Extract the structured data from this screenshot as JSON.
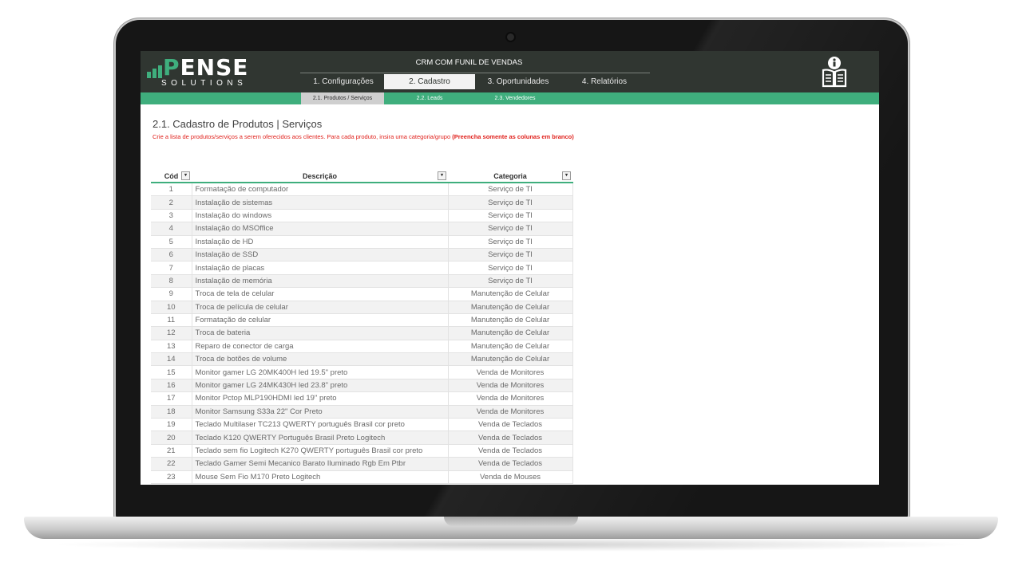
{
  "app": {
    "logo_main": "ENSE",
    "logo_letter": "P",
    "logo_sub": "SOLUTIONS",
    "title": "CRM COM FUNIL DE VENDAS"
  },
  "tabs": [
    {
      "label": "1. Configurações",
      "active": false
    },
    {
      "label": "2. Cadastro",
      "active": true
    },
    {
      "label": "3. Oportunidades",
      "active": false
    },
    {
      "label": "4. Relatórios",
      "active": false
    }
  ],
  "subtabs": [
    {
      "label": "2.1. Produtos / Serviços",
      "active": true
    },
    {
      "label": "2.2. Leads",
      "active": false
    },
    {
      "label": "2.3. Vendedores",
      "active": false
    }
  ],
  "page": {
    "title": "2.1. Cadastro de Produtos | Serviços",
    "instructions": "Crie a lista de produtos/serviços a serem oferecidos aos clientes. Para cada produto, insira uma categoria/grupo ",
    "instructions_bold": "(Preencha somente as colunas em branco)"
  },
  "table": {
    "headers": [
      "Cód",
      "Descrição",
      "Categoria"
    ],
    "filter_glyph": "▾",
    "rows": [
      [
        "1",
        "Formatação de computador",
        "Serviço de TI"
      ],
      [
        "2",
        "Instalação de sistemas",
        "Serviço de TI"
      ],
      [
        "3",
        "Instalação do windows",
        "Serviço de TI"
      ],
      [
        "4",
        "Instalação do MSOffice",
        "Serviço de TI"
      ],
      [
        "5",
        "Instalação de HD",
        "Serviço de TI"
      ],
      [
        "6",
        "Instalação de SSD",
        "Serviço de TI"
      ],
      [
        "7",
        "Instalação de placas",
        "Serviço de TI"
      ],
      [
        "8",
        "Instalação de memória",
        "Serviço de TI"
      ],
      [
        "9",
        "Troca de tela de celular",
        "Manutenção de Celular"
      ],
      [
        "10",
        "Troca de película de celular",
        "Manutenção de Celular"
      ],
      [
        "11",
        "Formatação de celular",
        "Manutenção de Celular"
      ],
      [
        "12",
        "Troca de bateria",
        "Manutenção de Celular"
      ],
      [
        "13",
        "Reparo de conector de carga",
        "Manutenção de Celular"
      ],
      [
        "14",
        "Troca de botões de volume",
        "Manutenção de Celular"
      ],
      [
        "15",
        "Monitor gamer LG 20MK400H led 19.5\" preto",
        "Venda de Monitores"
      ],
      [
        "16",
        "Monitor gamer LG 24MK430H led 23.8\" preto",
        "Venda de Monitores"
      ],
      [
        "17",
        "Monitor Pctop MLP190HDMI led 19\" preto",
        "Venda de Monitores"
      ],
      [
        "18",
        "Monitor Samsung S33a 22\" Cor Preto",
        "Venda de Monitores"
      ],
      [
        "19",
        "Teclado Multilaser TC213 QWERTY português Brasil cor preto",
        "Venda de Teclados"
      ],
      [
        "20",
        "Teclado K120 QWERTY Português Brasil Preto Logitech",
        "Venda de Teclados"
      ],
      [
        "21",
        "Teclado sem fio Logitech K270 QWERTY português Brasil cor preto",
        "Venda de Teclados"
      ],
      [
        "22",
        "Teclado Gamer Semi Mecanico Barato Iluminado Rgb Em Ptbr",
        "Venda de Teclados"
      ],
      [
        "23",
        "Mouse Sem Fio M170 Preto Logitech",
        "Venda de Mouses"
      ]
    ]
  },
  "icons": {
    "info": "info-book-icon",
    "logo": "logo-bars-icon"
  },
  "colors": {
    "accent": "#3fae7d",
    "header_bg": "#303631",
    "instruction_red": "#e0201b"
  }
}
